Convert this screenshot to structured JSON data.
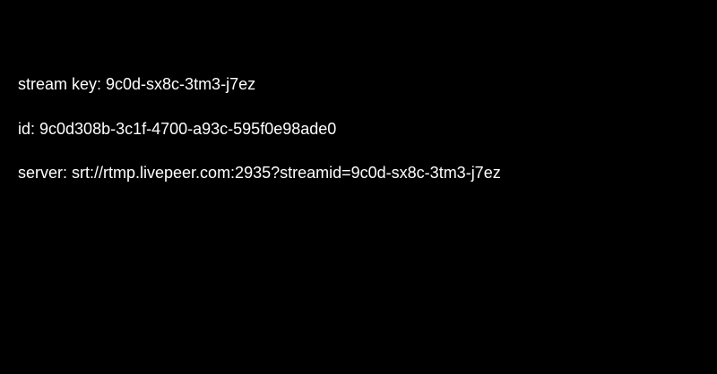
{
  "colors": {
    "background": "#000000",
    "text": "#ffffff"
  },
  "stream_info": {
    "stream_key_text": "stream key: 9c0d-sx8c-3tm3-j7ez",
    "id_text": "id: 9c0d308b-3c1f-4700-a93c-595f0e98ade0",
    "server_text": "server: srt://rtmp.livepeer.com:2935?streamid=9c0d-sx8c-3tm3-j7ez"
  }
}
